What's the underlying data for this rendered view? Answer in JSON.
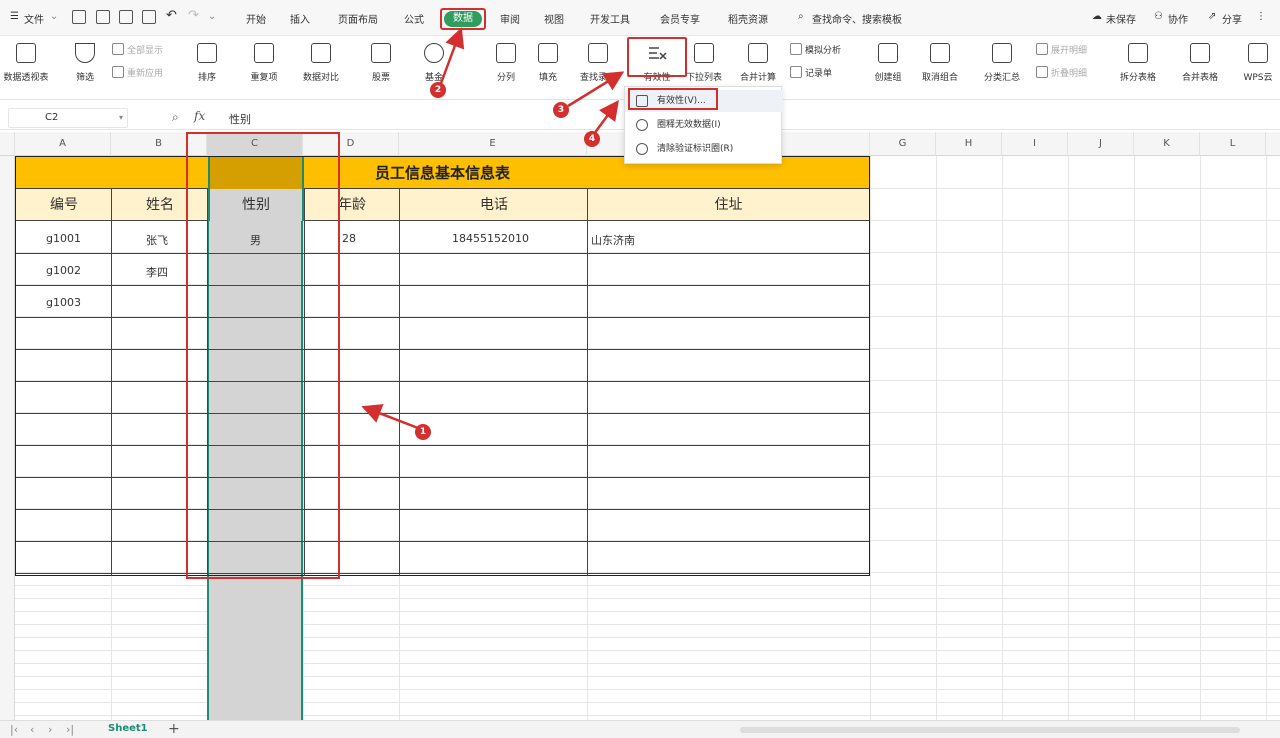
{
  "menubar": {
    "file": "文件",
    "tabs": [
      "开始",
      "插入",
      "页面布局",
      "公式",
      "数据",
      "审阅",
      "视图",
      "开发工具",
      "会员专享",
      "稻壳资源"
    ],
    "active_tab": "数据",
    "search": "查找命令、搜索模板",
    "unsaved": "未保存",
    "collab": "协作",
    "share": "分享"
  },
  "ribbon": {
    "pivot": "数据透视表",
    "filter": "筛选",
    "show_all": "全部显示",
    "reapply": "重新应用",
    "sort": "排序",
    "duplicates": "重复项",
    "compare": "数据对比",
    "stock": "股票",
    "fund": "基金",
    "split": "分列",
    "fill": "填充",
    "lookup": "查找录入",
    "validity": "有效性",
    "dropdown_list": "下拉列表",
    "consolidate": "合并计算",
    "simulate": "模拟分析",
    "record": "记录单",
    "create_group": "创建组",
    "ungroup": "取消组合",
    "subtotal": "分类汇总",
    "expand_detail": "展开明细",
    "collapse_detail": "折叠明细",
    "split_table": "拆分表格",
    "merge_table": "合并表格",
    "wps": "WPS云"
  },
  "dropdown": {
    "items": [
      "有效性(V)...",
      "圈释无效数据(I)",
      "清除验证标识圈(R)"
    ]
  },
  "formula_bar": {
    "cell_ref": "C2",
    "fx": "fx",
    "value": "性别"
  },
  "columns": [
    "A",
    "B",
    "C",
    "D",
    "E",
    "F",
    "G",
    "H",
    "I",
    "J",
    "K",
    "L"
  ],
  "table": {
    "title": "员工信息基本信息表",
    "headers": [
      "编号",
      "姓名",
      "性别",
      "年龄",
      "电话",
      "住址"
    ],
    "rows": [
      [
        "g1001",
        "张飞",
        "男",
        "28",
        "18455152010",
        "山东济南"
      ],
      [
        "g1002",
        "李四",
        "",
        "",
        "",
        ""
      ],
      [
        "g1003",
        "",
        "",
        "",
        "",
        ""
      ]
    ]
  },
  "annotations": {
    "badges": [
      "1",
      "2",
      "3",
      "4"
    ]
  },
  "sheetbar": {
    "sheet_name": "Sheet1",
    "add": "+"
  }
}
